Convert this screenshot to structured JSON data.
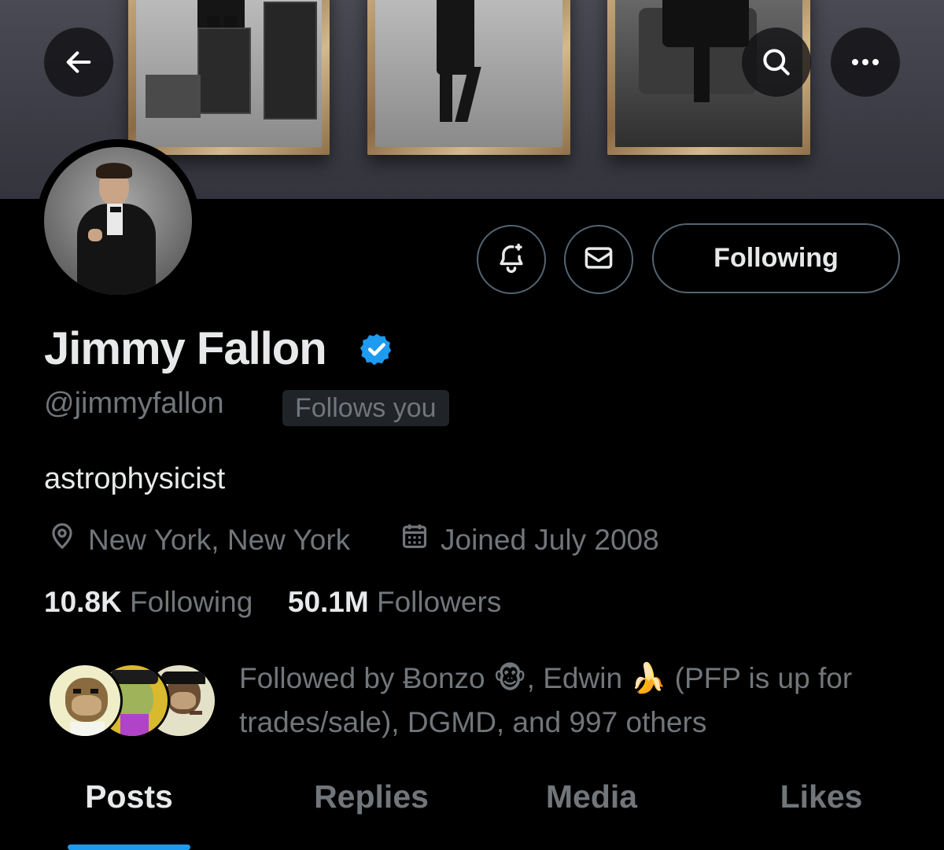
{
  "profile": {
    "display_name": "Jimmy Fallon",
    "handle": "@jimmyfallon",
    "follows_you_badge": "Follows you",
    "bio": "astrophysicist",
    "location": "New York, New York",
    "joined": "Joined July 2008",
    "following_count": "10.8K",
    "following_label": "Following",
    "followers_count": "50.1M",
    "followers_label": "Followers"
  },
  "actions": {
    "follow_button_label": "Following"
  },
  "followed_by": {
    "text": "Followed by Ƀonzo 🐵, Edwin 🍌 (PFP is up for trades/sale), DGMD, and 997 others"
  },
  "tabs": [
    {
      "label": "Posts",
      "active": true
    },
    {
      "label": "Replies",
      "active": false
    },
    {
      "label": "Media",
      "active": false
    },
    {
      "label": "Likes",
      "active": false
    }
  ],
  "icons": {
    "back": "back-arrow-icon",
    "search": "search-icon",
    "more": "more-options-icon",
    "notify": "bell-plus-icon",
    "message": "envelope-icon",
    "verified": "verified-badge-icon",
    "location": "location-pin-icon",
    "calendar": "calendar-icon"
  },
  "colors": {
    "background": "#000000",
    "accent": "#1d9bf0",
    "primary_text": "#e7e9ea",
    "secondary_text": "#71767b",
    "border": "#536471"
  }
}
